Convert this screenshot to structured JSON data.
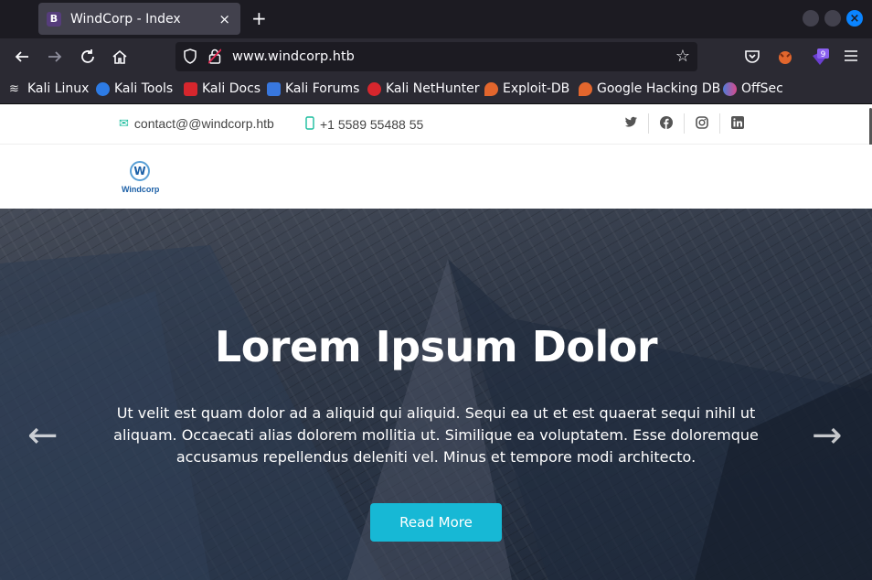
{
  "browser": {
    "tab": {
      "title": "WindCorp - Index",
      "favicon_letter": "B"
    },
    "new_tab_symbol": "+",
    "close_symbol": "×",
    "url": "www.windcorp.htb",
    "extension_badge": "9",
    "bookmarks": [
      {
        "label": "Kali Linux",
        "icon": "kali-dragon-icon",
        "color": "#e8e8e8"
      },
      {
        "label": "Kali Tools",
        "icon": "kali-tools-icon",
        "color": "#2d7be5"
      },
      {
        "label": "Kali Docs",
        "icon": "kali-docs-icon",
        "color": "#d6262d"
      },
      {
        "label": "Kali Forums",
        "icon": "kali-forums-icon",
        "color": "#3877de"
      },
      {
        "label": "Kali NetHunter",
        "icon": "kali-nethunter-icon",
        "color": "#d6262d"
      },
      {
        "label": "Exploit-DB",
        "icon": "exploit-db-icon",
        "color": "#e2662d"
      },
      {
        "label": "Google Hacking DB",
        "icon": "ghdb-icon",
        "color": "#e2662d"
      },
      {
        "label": "OffSec",
        "icon": "offsec-icon",
        "color": "#4f7cd9"
      }
    ]
  },
  "site": {
    "contact_email": "contact@@windcorp.htb",
    "contact_phone": "+1 5589 55488 55",
    "social": [
      {
        "name": "twitter-icon",
        "glyph": "🐦"
      },
      {
        "name": "facebook-icon",
        "glyph": "f"
      },
      {
        "name": "instagram-icon",
        "glyph": "◎"
      },
      {
        "name": "linkedin-icon",
        "glyph": "in"
      }
    ],
    "logo_text": "Windcorp",
    "logo_letter": "W",
    "hero": {
      "title": "Lorem Ipsum Dolor",
      "text": "Ut velit est quam dolor ad a aliquid qui aliquid. Sequi ea ut et est quaerat sequi nihil ut aliquam. Occaecati alias dolorem mollitia ut. Similique ea voluptatem. Esse doloremque accusamus repellendus deleniti vel. Minus et tempore modi architecto.",
      "button": "Read More",
      "prev_symbol": "←",
      "next_symbol": "→"
    },
    "accent_color": "#17b8d5"
  }
}
